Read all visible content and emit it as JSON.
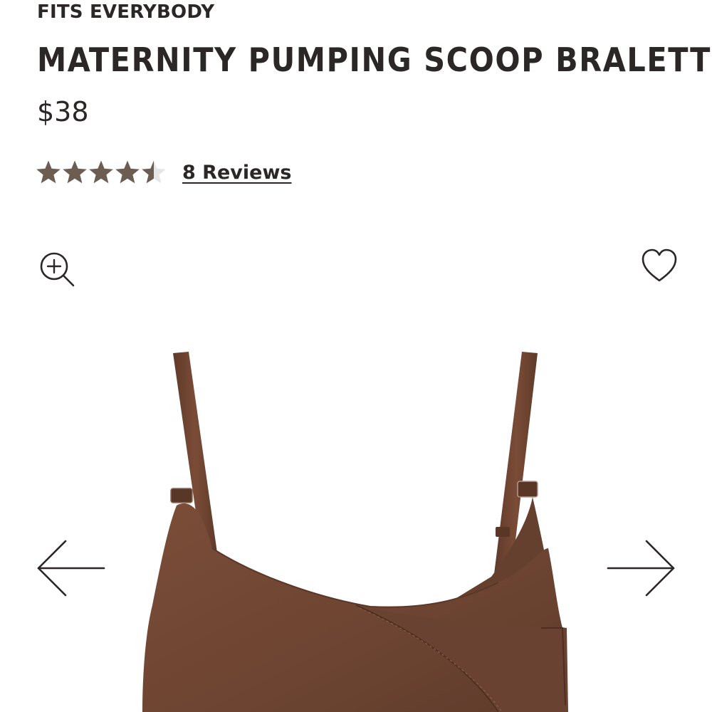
{
  "product": {
    "collection": "FITS EVERYBODY",
    "title": "MATERNITY PUMPING SCOOP BRALETTE",
    "price": "$38",
    "rating": 4.5,
    "rating_max": 5,
    "reviews_label": "8 Reviews"
  },
  "colors": {
    "text": "#2b2726",
    "star_filled": "#6b5d52",
    "star_empty": "#e6e6e6",
    "garment": "#6e4532"
  },
  "icons": {
    "zoom": "zoom-in-icon",
    "wishlist": "heart-outline-icon",
    "prev": "arrow-left-icon",
    "next": "arrow-right-icon"
  }
}
